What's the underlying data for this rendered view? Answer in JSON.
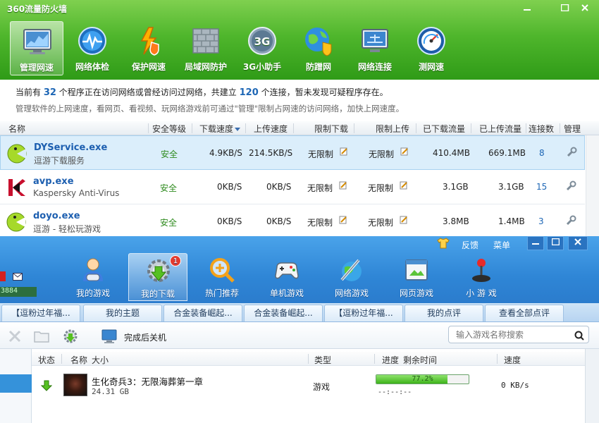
{
  "firewall": {
    "title": "360流量防火墙",
    "tabs": [
      {
        "label": "管理网速",
        "icon": "monitor-chart-icon"
      },
      {
        "label": "网络体检",
        "icon": "network-check-icon"
      },
      {
        "label": "保护网速",
        "icon": "shield-lightning-icon"
      },
      {
        "label": "局域网防护",
        "icon": "brick-wall-icon"
      },
      {
        "label": "3G小助手",
        "icon": "3g-icon"
      },
      {
        "label": "防蹭网",
        "icon": "globe-shield-icon"
      },
      {
        "label": "网络连接",
        "icon": "network-connection-icon"
      },
      {
        "label": "测网速",
        "icon": "speedometer-icon"
      }
    ],
    "info": {
      "line1_a": "当前有",
      "program_count": "32",
      "line1_b": "个程序正在访问网络或曾经访问过网络，共建立",
      "connection_count": "120",
      "line1_c": "个连接，暂未发现可疑程序存在。",
      "line2": "管理软件的上网速度，看网页、看视频、玩网络游戏前可通过\"管理\"限制占网速的访问网络，加快上网速度。"
    },
    "columns": {
      "name": "名称",
      "safety": "安全等级",
      "down_speed": "下载速度",
      "up_speed": "上传速度",
      "limit_down": "限制下载",
      "limit_up": "限制上传",
      "downloaded": "已下载流量",
      "uploaded": "已上传流量",
      "conns": "连接数",
      "manage": "管理"
    },
    "rows": [
      {
        "name": "DYService.exe",
        "desc": "逗游下载服务",
        "safety": "安全",
        "down": "4.9KB/S",
        "up": "214.5KB/S",
        "limit_down": "无限制",
        "limit_up": "无限制",
        "downloaded": "410.4MB",
        "uploaded": "669.1MB",
        "conns": "8"
      },
      {
        "name": "avp.exe",
        "desc": "Kaspersky Anti-Virus",
        "safety": "安全",
        "down": "0KB/S",
        "up": "0KB/S",
        "limit_down": "无限制",
        "limit_up": "无限制",
        "downloaded": "3.1GB",
        "uploaded": "3.1GB",
        "conns": "15"
      },
      {
        "name": "doyo.exe",
        "desc": "逗游 - 轻松玩游戏",
        "safety": "安全",
        "down": "0KB/S",
        "up": "0KB/S",
        "limit_down": "无限制",
        "limit_up": "无限制",
        "downloaded": "3.8MB",
        "uploaded": "1.4MB",
        "conns": "3"
      }
    ]
  },
  "game_client": {
    "feedback": "反馈",
    "menu": "菜单",
    "left_number": "3884",
    "tabs": [
      {
        "label": "我的游戏",
        "icon": "user-gamepad-icon"
      },
      {
        "label": "我的下载",
        "icon": "gear-download-icon",
        "badge": "1"
      },
      {
        "label": "热门推荐",
        "icon": "search-plus-icon"
      },
      {
        "label": "单机游戏",
        "icon": "gamepad-icon"
      },
      {
        "label": "网络游戏",
        "icon": "sword-globe-icon"
      },
      {
        "label": "网页游戏",
        "icon": "browser-window-icon"
      },
      {
        "label": "小 游 戏",
        "icon": "joystick-icon"
      }
    ],
    "news_tabs": [
      "【逗粉过年福...",
      "我的主题",
      "合金装备崛起...",
      "合金装备崛起...",
      "【逗粉过年福...",
      "我的点评",
      "查看全部点评"
    ],
    "toolbar": {
      "shutdown_label": "完成后关机",
      "search_placeholder": "输入游戏名称搜索"
    },
    "columns": {
      "status": "状态",
      "name": "名称",
      "size": "大小",
      "type": "类型",
      "progress": "进度",
      "remaining": "剩余时间",
      "speed": "速度"
    },
    "download": {
      "name": "生化奇兵3：无限海葬第一章",
      "size": "24.31 GB",
      "type": "游戏",
      "progress": 0.772,
      "progress_text": "77.2%",
      "remaining": "--:--:--",
      "speed": "0 KB/s"
    }
  }
}
